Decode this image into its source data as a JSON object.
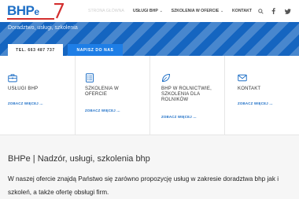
{
  "logo": {
    "text_main": "BHP",
    "text_e": "e"
  },
  "nav": {
    "items": [
      {
        "label": "Strona główna",
        "active": true,
        "dropdown": false
      },
      {
        "label": "Usługi BHP",
        "active": false,
        "dropdown": true
      },
      {
        "label": "Szkolenia w ofercie",
        "active": false,
        "dropdown": true
      },
      {
        "label": "Kontakt",
        "active": false,
        "dropdown": false
      }
    ],
    "icons": [
      "search-icon",
      "facebook-icon",
      "twitter-icon"
    ]
  },
  "hero": {
    "subtitle": "Doradztwo, usługi, szkolenia",
    "phone_button": "TEL. 663 487 737",
    "write_button": "NAPISZ DO NAS",
    "accent": "#1565c0"
  },
  "services": [
    {
      "icon": "briefcase-icon",
      "title": "USŁUGI BHP",
      "link": "ZOBACZ WIĘCEJ ..."
    },
    {
      "icon": "document-list-icon",
      "title": "SZKOLENIA W OFERCIE",
      "link": "ZOBACZ WIĘCEJ ..."
    },
    {
      "icon": "leaf-icon",
      "title": "BHP W ROLNICTWIE, SZKOLENIA DLA ROLNIKÓW",
      "link": "ZOBACZ WIĘCEJ ..."
    },
    {
      "icon": "mail-icon",
      "title": "KONTAKT",
      "link": "ZOBACZ WIĘCEJ ..."
    }
  ],
  "content": {
    "title": "BHPe | Nadzór, usługi, szkolenia bhp",
    "paragraph": "W naszej ofercie znajdą Państwo się zarówno propozycję usług w zakresie doradztwa bhp jak i szkoleń, a także ofertę obsługi firm."
  },
  "colors": {
    "brand_blue": "#1e6fc6",
    "brand_red": "#d32f2f",
    "link": "#1e6fc6"
  }
}
